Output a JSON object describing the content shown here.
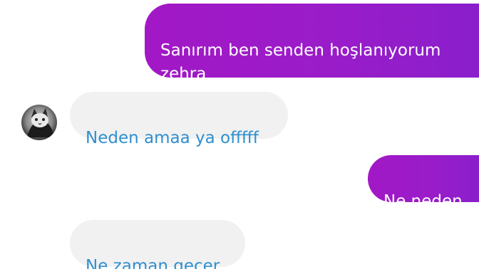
{
  "conversation": {
    "messages": [
      {
        "direction": "outgoing",
        "text": "Sanırım ben senden hoşlanıyorum\nzehra"
      },
      {
        "direction": "incoming",
        "text": "Neden amaa ya offfff"
      },
      {
        "direction": "outgoing",
        "text": "Ne neden"
      },
      {
        "direction": "incoming",
        "text": "Ne zaman geçer"
      }
    ]
  },
  "contact": {
    "avatar_icon": "cat-photo-avatar"
  },
  "colors": {
    "outgoing_bubble": "#9a1cc9",
    "outgoing_text": "#ffffff",
    "incoming_bubble": "#f1f1f1",
    "incoming_text": "#2f8fd0"
  }
}
